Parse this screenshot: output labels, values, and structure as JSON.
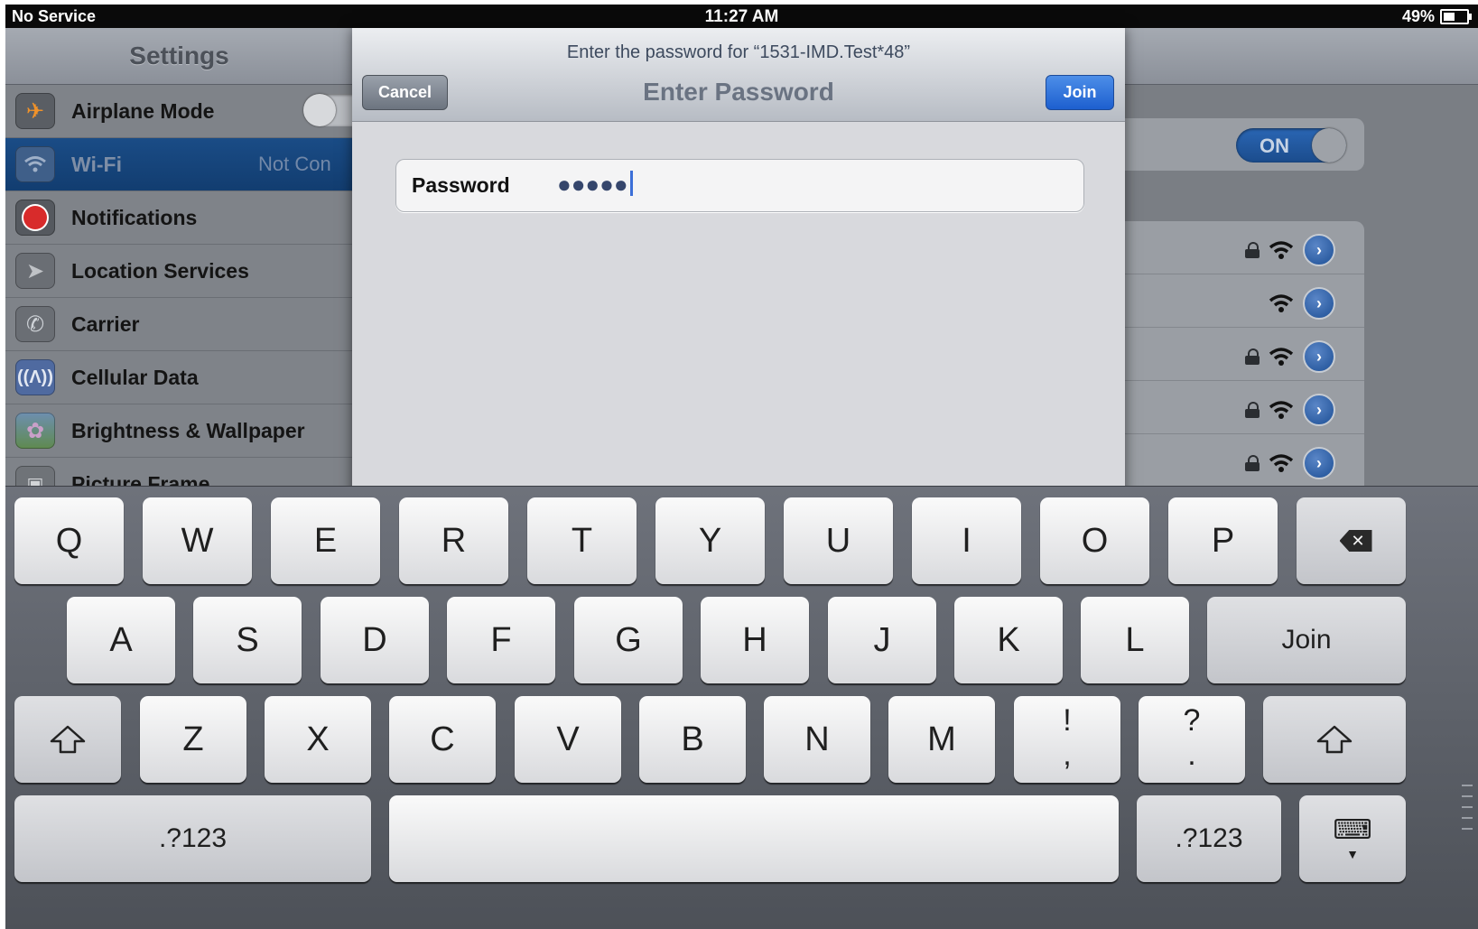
{
  "status_bar": {
    "carrier": "No Service",
    "time": "11:27 AM",
    "battery": "49%"
  },
  "settings": {
    "title": "Settings",
    "items": [
      {
        "label": "Airplane Mode",
        "value": "",
        "icon": "airplane-icon",
        "color": "#f0922a"
      },
      {
        "label": "Wi-Fi",
        "value": "Not Con",
        "icon": "wifi-icon",
        "color": "#2b5fa4",
        "selected": true
      },
      {
        "label": "Notifications",
        "value": "",
        "icon": "notifications-icon",
        "color": "#d82b2b"
      },
      {
        "label": "Location Services",
        "value": "",
        "icon": "location-icon",
        "color": "#8e9297"
      },
      {
        "label": "Carrier",
        "value": "",
        "icon": "phone-icon",
        "color": "#5e88c9"
      },
      {
        "label": "Cellular Data",
        "value": "",
        "icon": "antenna-icon",
        "color": "#4f6aa0"
      },
      {
        "label": "Brightness & Wallpaper",
        "value": "",
        "icon": "flower-icon",
        "color": "#6a8f5a"
      },
      {
        "label": "Picture Frame",
        "value": "",
        "icon": "picture-frame-icon",
        "color": "#8c8f93"
      }
    ]
  },
  "wifi": {
    "toggle_label": "ON",
    "networks": [
      {
        "secured": true
      },
      {
        "secured": false
      },
      {
        "secured": true
      },
      {
        "secured": true
      },
      {
        "secured": true
      }
    ]
  },
  "dialog": {
    "prompt": "Enter the password for “1531-IMD.Test*48”",
    "title": "Enter Password",
    "cancel_label": "Cancel",
    "join_label": "Join",
    "password_label": "Password",
    "password_value": "●●●●●"
  },
  "keyboard": {
    "row1": [
      "Q",
      "W",
      "E",
      "R",
      "T",
      "Y",
      "U",
      "I",
      "O",
      "P"
    ],
    "row2": [
      "A",
      "S",
      "D",
      "F",
      "G",
      "H",
      "J",
      "K",
      "L"
    ],
    "row3": [
      "Z",
      "X",
      "C",
      "V",
      "B",
      "N",
      "M"
    ],
    "exclam_comma": [
      "!",
      ","
    ],
    "question_period": [
      "?",
      "."
    ],
    "join_label": "Join",
    "numbers_label": ".?123"
  }
}
